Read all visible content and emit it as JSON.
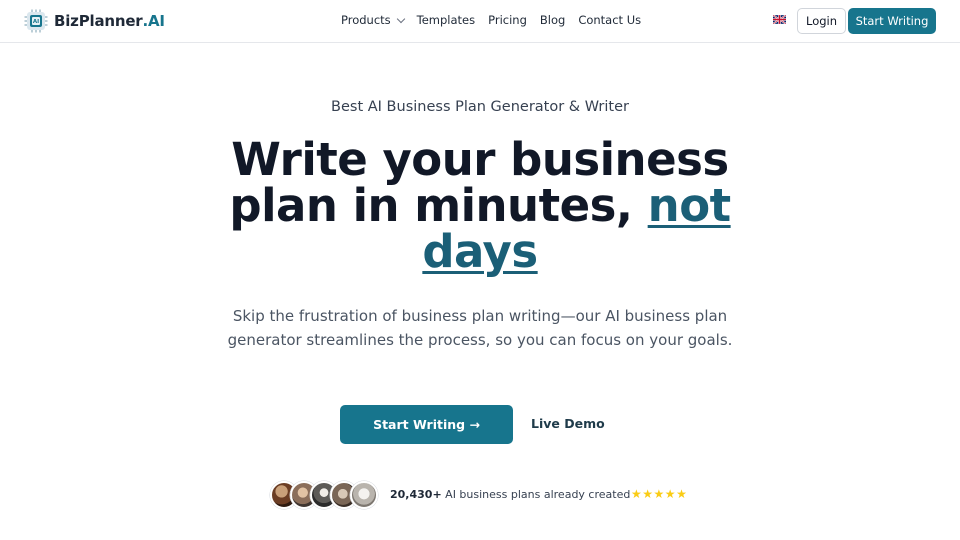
{
  "header": {
    "logo": {
      "name": "BizPlanner",
      "accent": ".AI"
    },
    "nav": [
      {
        "label": "Products",
        "has_dropdown": true
      },
      {
        "label": "Templates"
      },
      {
        "label": "Pricing"
      },
      {
        "label": "Blog"
      },
      {
        "label": "Contact Us"
      }
    ],
    "language_icon": "uk-flag-icon",
    "login_label": "Login",
    "start_label": "Start Writing"
  },
  "hero": {
    "eyebrow": "Best AI Business Plan Generator & Writer",
    "headline_main": "Write your business plan in minutes, ",
    "headline_accent": "not days",
    "subtext": "Skip the frustration of business plan writing—our AI business plan generator streamlines the process, so you can focus on your goals.",
    "cta_primary": "Start Writing →",
    "cta_secondary": "Live Demo"
  },
  "social_proof": {
    "count": "20,430+",
    "text": " AI business plans already created",
    "rating": 5,
    "avatars": 5
  },
  "colors": {
    "primary": "#17758d",
    "accent_text": "#1b5f77",
    "star": "#facc15"
  }
}
